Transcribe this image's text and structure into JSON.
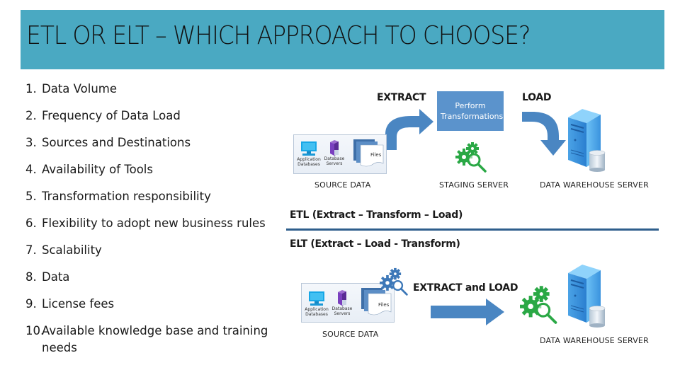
{
  "slide": {
    "title": "ETL OR ELT – WHICH APPROACH TO CHOOSE?",
    "colors": {
      "title_bar": "#4aa9c2",
      "arrow_blue": "#4a86c2",
      "staging_box": "#5b93cc",
      "gear_green": "#2aa845",
      "gear_blue": "#3d78b8",
      "divider": "#2e5e8c"
    }
  },
  "criteria": [
    {
      "num": "1.",
      "text": "Data Volume"
    },
    {
      "num": "2.",
      "text": "Frequency of Data Load"
    },
    {
      "num": "3.",
      "text": "Sources and Destinations"
    },
    {
      "num": "4.",
      "text": "Availability of Tools"
    },
    {
      "num": "5.",
      "text": "Transformation responsibility"
    },
    {
      "num": "6.",
      "text": "Flexibility to adopt new business rules"
    },
    {
      "num": "7.",
      "text": "Scalability"
    },
    {
      "num": "8.",
      "text": "Data"
    },
    {
      "num": "9.",
      "text": "License fees"
    },
    {
      "num": "10.",
      "text": "Available knowledge base and training needs"
    }
  ],
  "etl": {
    "heading": "ETL (Extract – Transform – Load)",
    "extract_label": "EXTRACT",
    "load_label": "LOAD",
    "staging_box_text": "Perform Transformations",
    "source_caption": "SOURCE DATA",
    "staging_caption": "STAGING SERVER",
    "warehouse_caption": "DATA WAREHOUSE SERVER",
    "source_items": {
      "app_db": "Application Databases",
      "db_servers": "Database Servers",
      "files": "Files"
    }
  },
  "elt": {
    "heading": "ELT (Extract – Load - Transform)",
    "extract_load_label": "EXTRACT and LOAD",
    "source_caption": "SOURCE DATA",
    "warehouse_caption": "DATA WAREHOUSE SERVER",
    "source_items": {
      "app_db": "Application Databases",
      "db_servers": "Database Servers",
      "files": "Files"
    }
  }
}
